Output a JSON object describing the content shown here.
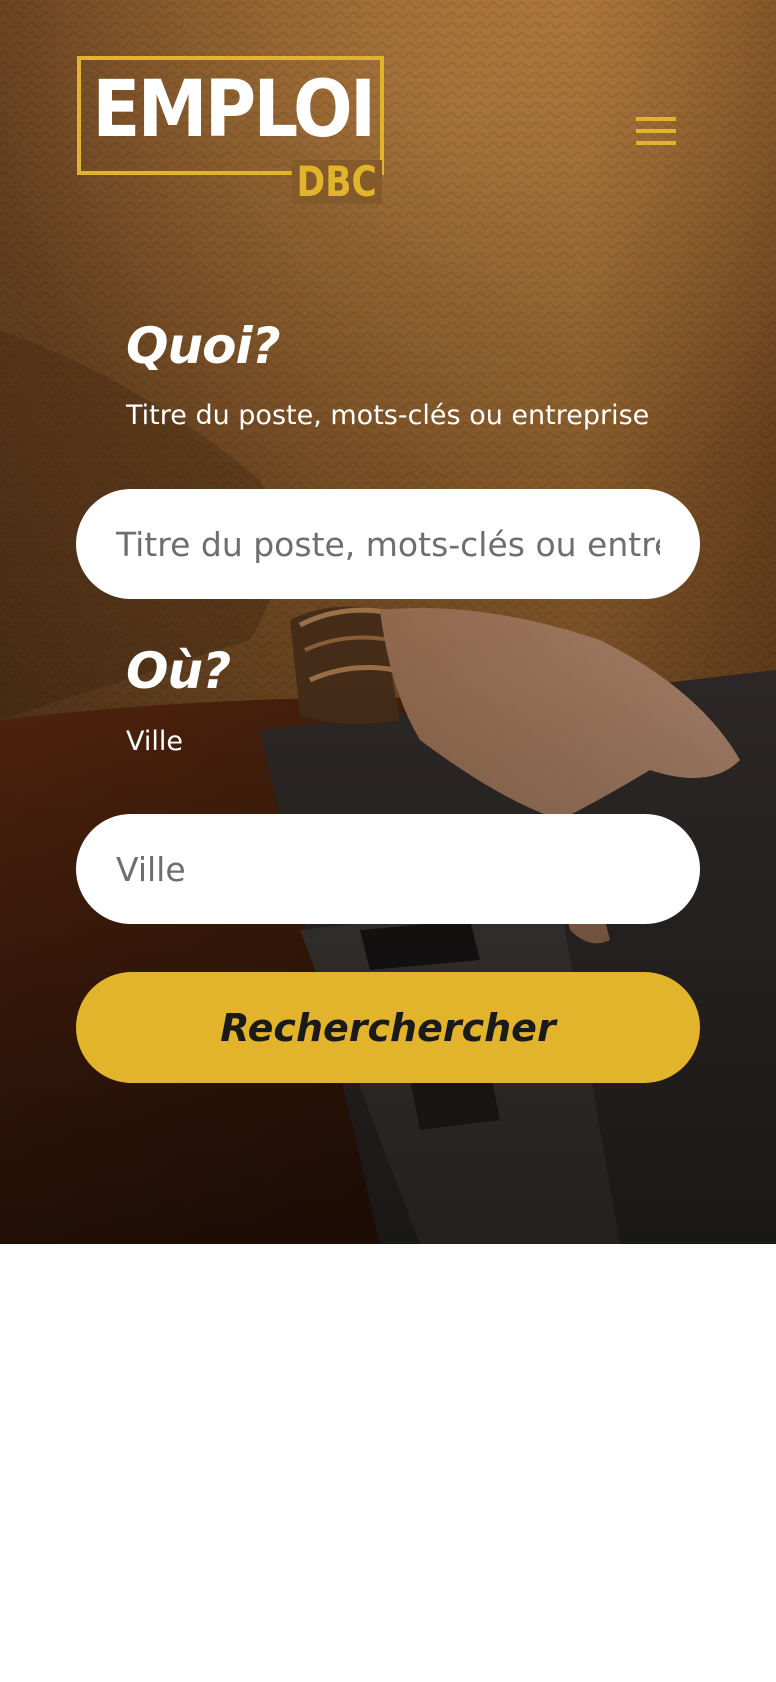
{
  "header": {
    "logo_main": "EMPLOI",
    "logo_sub": "DBC",
    "menu_icon": "hamburger-menu-icon"
  },
  "search": {
    "what_title": "Quoi?",
    "what_desc": "Titre du poste, mots-clés ou entreprise",
    "what_placeholder": "Titre du poste, mots-clés ou entreprise",
    "where_title": "Où?",
    "where_desc": "Ville",
    "where_placeholder": "Ville",
    "submit_label": "Recherchercher"
  },
  "colors": {
    "accent": "#e2b42b",
    "input_bg": "#ffffff",
    "text_light": "#ffffff",
    "button_text": "#1a1a1a"
  }
}
